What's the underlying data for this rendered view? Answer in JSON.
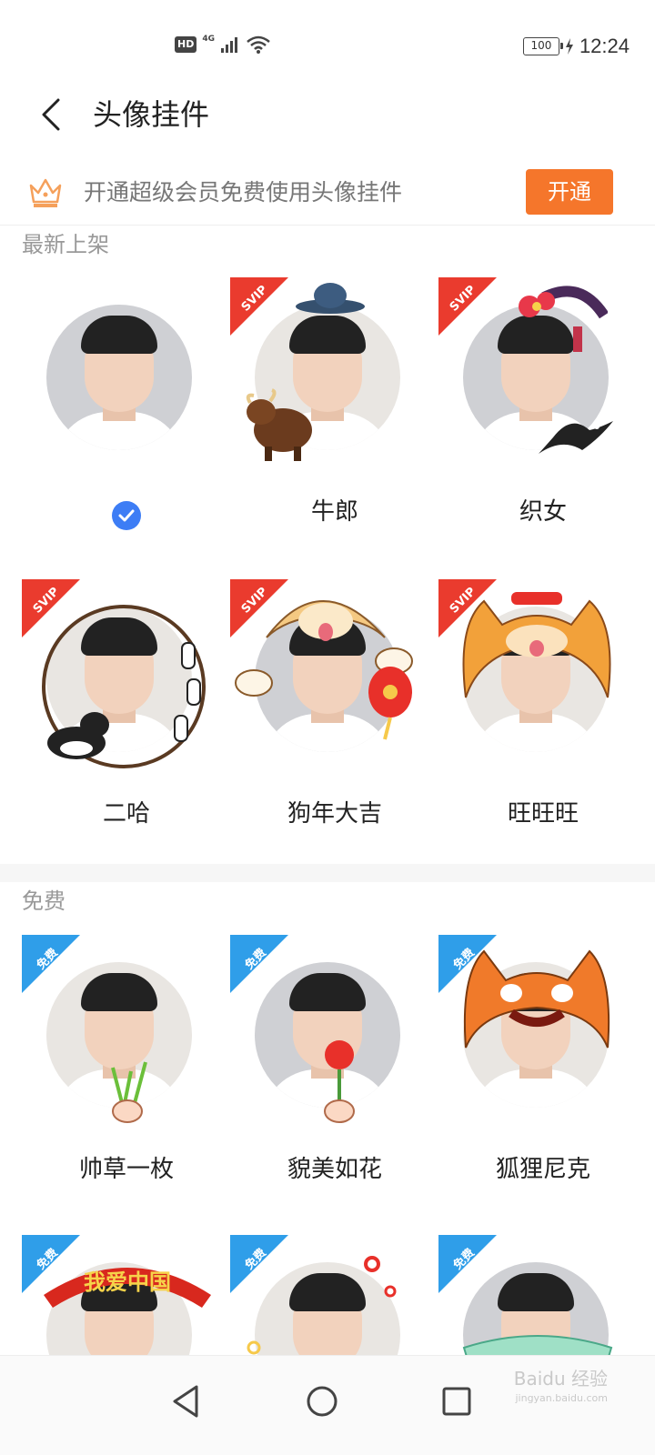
{
  "status_bar": {
    "hd": "HD",
    "network": "4G",
    "battery": "100",
    "time": "12:24"
  },
  "header": {
    "title": "头像挂件"
  },
  "banner": {
    "text": "开通超级会员免费使用头像挂件",
    "button_label": "开通"
  },
  "sections": {
    "latest_title": "最新上架",
    "free_title": "免费"
  },
  "latest_items": [
    {
      "name": "",
      "badge": "",
      "selected": true
    },
    {
      "name": "牛郎",
      "badge": "SVIP"
    },
    {
      "name": "织女",
      "badge": "SVIP"
    },
    {
      "name": "二哈",
      "badge": "SVIP"
    },
    {
      "name": "狗年大吉",
      "badge": "SVIP"
    },
    {
      "name": "旺旺旺",
      "badge": "SVIP"
    }
  ],
  "free_items": [
    {
      "name": "帅草一枚",
      "badge": "免费"
    },
    {
      "name": "貌美如花",
      "badge": "免费"
    },
    {
      "name": "狐狸尼克",
      "badge": "免费"
    },
    {
      "name": "",
      "badge": "免费",
      "banner_text": "我爱中国"
    },
    {
      "name": "",
      "badge": "免费"
    },
    {
      "name": "",
      "badge": "免费"
    }
  ],
  "watermark": {
    "line1": "Baidu 经验",
    "line2": "jingyan.baidu.com"
  },
  "colors": {
    "accent_orange": "#f5762b",
    "svip_red": "#ea3b2e",
    "free_blue": "#2f9ee9",
    "check_blue": "#3d7df5"
  }
}
